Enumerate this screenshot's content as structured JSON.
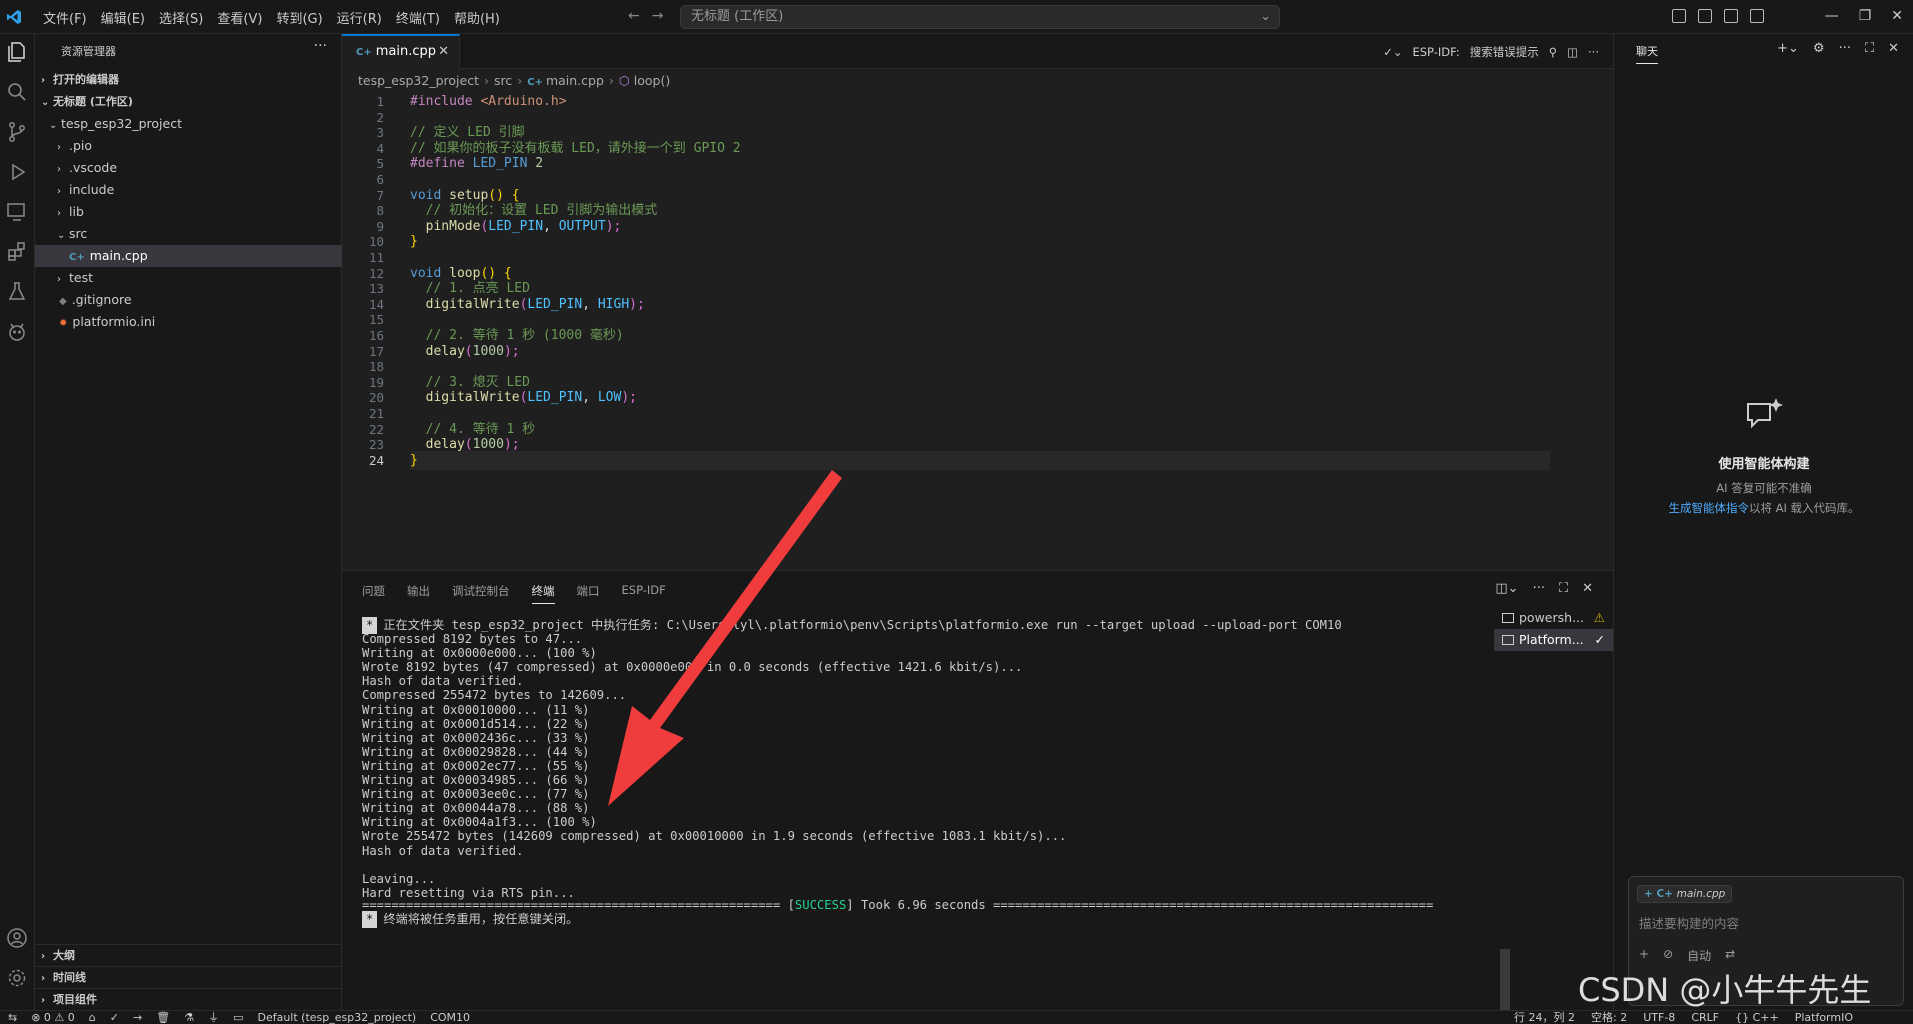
{
  "menu": [
    "文件(F)",
    "编辑(E)",
    "选择(S)",
    "查看(V)",
    "转到(G)",
    "运行(R)",
    "终端(T)",
    "帮助(H)"
  ],
  "command_center": {
    "text": "无标题 (工作区)"
  },
  "sidebar": {
    "title": "资源管理器",
    "open_editors": "打开的编辑器",
    "workspace": "无标题 (工作区)",
    "project": "tesp_esp32_project",
    "items": [
      ".pio",
      ".vscode",
      "include",
      "lib",
      "src",
      "main.cpp",
      "test",
      ".gitignore",
      "platformio.ini"
    ],
    "bottom_sections": [
      "大纲",
      "时间线",
      "项目组件"
    ]
  },
  "editor": {
    "tab_label": "main.cpp",
    "actions_label": "ESP-IDF:",
    "actions_search": "搜索错误提示",
    "breadcrumb": [
      "tesp_esp32_project",
      "src",
      "main.cpp",
      "loop()"
    ],
    "line_numbers": [
      "1",
      "2",
      "3",
      "4",
      "5",
      "6",
      "7",
      "8",
      "9",
      "10",
      "11",
      "12",
      "13",
      "14",
      "15",
      "16",
      "17",
      "18",
      "19",
      "20",
      "21",
      "22",
      "23",
      "24"
    ],
    "code": {
      "l1a": "#include",
      "l1b": " <Arduino.h>",
      "l3": "// 定义 LED 引脚",
      "l4": "// 如果你的板子没有板载 LED，请外接一个到 GPIO 2",
      "l5a": "#define",
      "l5b": " LED_PIN",
      "l5c": " 2",
      "l7a": "void",
      "l7b": " setup",
      "l7c": "() {",
      "l8": "  // 初始化：设置 LED 引脚为输出模式",
      "l9a": "  pinMode",
      "l9b": "(",
      "l9c": "LED_PIN",
      "l9d": ", ",
      "l9e": "OUTPUT",
      "l9f": ");",
      "l10": "}",
      "l12a": "void",
      "l12b": " loop",
      "l12c": "() {",
      "l13": "  // 1. 点亮 LED",
      "l14a": "  digitalWrite",
      "l14b": "(",
      "l14c": "LED_PIN",
      "l14d": ", ",
      "l14e": "HIGH",
      "l14f": ");",
      "l16": "  // 2. 等待 1 秒 (1000 毫秒)",
      "l17a": "  delay",
      "l17b": "(",
      "l17c": "1000",
      "l17d": ");",
      "l19": "  // 3. 熄灭 LED",
      "l20a": "  digitalWrite",
      "l20b": "(",
      "l20c": "LED_PIN",
      "l20d": ", ",
      "l20e": "LOW",
      "l20f": ");",
      "l22": "  // 4. 等待 1 秒",
      "l23a": "  delay",
      "l23b": "(",
      "l23c": "1000",
      "l23d": ");",
      "l24": "}"
    }
  },
  "panel": {
    "tabs": [
      "问题",
      "输出",
      "调试控制台",
      "终端",
      "端口",
      "ESP-IDF"
    ],
    "active_tab": "终端",
    "terminal_first": "正在文件夹 tesp_esp32_project 中执行任务: C:\\Users\\lyl\\.platformio\\penv\\Scripts\\platformio.exe run --target upload --upload-port COM10",
    "terminal_lines": [
      "Compressed 8192 bytes to 47...",
      "Writing at 0x0000e000... (100 %)",
      "Wrote 8192 bytes (47 compressed) at 0x0000e000 in 0.0 seconds (effective 1421.6 kbit/s)...",
      "Hash of data verified.",
      "Compressed 255472 bytes to 142609...",
      "Writing at 0x00010000... (11 %)",
      "Writing at 0x0001d514... (22 %)",
      "Writing at 0x0002436c... (33 %)",
      "Writing at 0x00029828... (44 %)",
      "Writing at 0x0002ec77... (55 %)",
      "Writing at 0x00034985... (66 %)",
      "Writing at 0x0003ee0c... (77 %)",
      "Writing at 0x00044a78... (88 %)",
      "Writing at 0x0004a1f3... (100 %)",
      "Wrote 255472 bytes (142609 compressed) at 0x00010000 in 1.9 seconds (effective 1083.1 kbit/s)...",
      "Hash of data verified.",
      "",
      "Leaving...",
      "Hard resetting via RTS pin..."
    ],
    "success_left": "========================================================= [",
    "success_word": "SUCCESS",
    "success_right": "] Took 6.96 seconds ============================================================",
    "terminal_last": "终端将被任务重用，按任意键关闭。",
    "terminals": [
      "powersh...",
      "Platform..."
    ]
  },
  "chat": {
    "title": "聊天",
    "heading": "使用智能体构建",
    "line1": "AI 答复可能不准确",
    "link": "生成智能体指令",
    "line2": "以将 AI 载入代码库。",
    "chip": "main.cpp",
    "placeholder": "描述要构建的内容",
    "mode": "自动"
  },
  "statusbar": {
    "errors": "⊗ 0 ⚠ 0",
    "env": "Default (tesp_esp32_project)",
    "port": "COM10",
    "position": "行 24，列 2",
    "spaces": "空格: 2",
    "encoding": "UTF-8",
    "eol": "CRLF",
    "lang": "{} C++",
    "ext": "PlatformIO"
  },
  "watermark": "CSDN @小牛牛先生",
  "colors": {
    "accent": "#0078d4",
    "success": "#23d18b",
    "arrow": "#f03c3c",
    "link": "#4daafc"
  }
}
